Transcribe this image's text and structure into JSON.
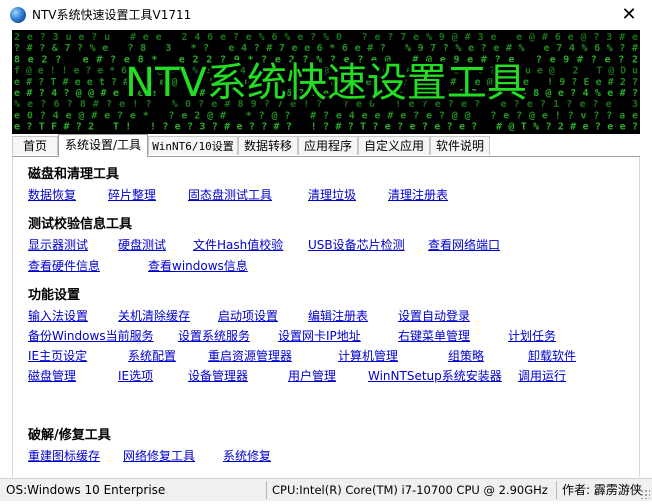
{
  "window": {
    "title": "NTV系统快速设置工具V1711",
    "close_symbol": "✕"
  },
  "banner": {
    "title": "NTV系统快速设置工具",
    "title_color": "#22dd22",
    "matrix_color": "#33cc33",
    "rows": [
      "2e?3ue?u  #ee  246e?e%6%e?%0  ?e?7e%9@#3e  e@#6e@?3#e",
      "?#?&7?%e  ?8 3  *? e4?#7ee6*6e#? %97?%e?e#%  e74%6%?#",
      "8e2?  e#?e8*  e22?9*?e2?%?e?e@  #@e9e#?e  ?e9#?e?2",
      "f@e!!e?e*6e   @8?%e? 4  ? e?#@ e?  e?e9? 2 8?29ue@ 2 T@Du",
      "e#?T#eet?#?  e@2*!#?u#?  @?e?% e?e?e?  #?e@e?e  !9?Ee#2?",
      "e#?4?@@#e?ee?  ?#T?3?  e6??e?4?e?%  uve?2e? #8@e?4%e#?",
      "%e?6?8#?e!?  %0?e#89?7e!?  ?e0 !e?e?e?  e?e?1?e?e 3",
      "e0?4e@#e?e*  ?e2@#  *?@?  #?e4ee#e?e?@@  ?e?@e!?v??ae",
      "e?TF#?2 T!  !?e?3?#e??#?  !?#?T?e?e?e?e?  #@T%?2#e?ee?"
    ]
  },
  "tabs": [
    {
      "label": "首页"
    },
    {
      "label": "系统设置/工具"
    },
    {
      "label": "WinNT6/10设置"
    },
    {
      "label": "数据转移"
    },
    {
      "label": "应用程序"
    },
    {
      "label": "自定义应用"
    },
    {
      "label": "软件说明"
    }
  ],
  "sections": {
    "disk": {
      "title": "磁盘和清理工具",
      "links": [
        "数据恢复",
        "碎片整理",
        "固态盘测试工具",
        "清理垃圾",
        "清理注册表"
      ]
    },
    "test": {
      "title": "测试校验信息工具",
      "links": [
        "显示器测试",
        "硬盘测试",
        "文件Hash值校验",
        "USB设备芯片检测",
        "查看网络端口",
        "查看硬件信息",
        "查看windows信息"
      ]
    },
    "func": {
      "title": "功能设置",
      "links": [
        "输入法设置",
        "关机清除缓存",
        "启动项设置",
        "编辑注册表",
        "设置自动登录",
        "备份Windows当前服务",
        "设置系统服务",
        "设置网卡IP地址",
        "右键菜单管理",
        "计划任务",
        "IE主页设定",
        "系统配置",
        "重启资源管理器",
        "计算机管理",
        "组策略",
        "卸载软件",
        "磁盘管理",
        "IE选项",
        "设备管理器",
        "用户管理",
        "WinNTSetup系统安装器",
        "调用运行"
      ]
    },
    "repair": {
      "title": "破解/修复工具",
      "links": [
        "重建图标缓存",
        "网络修复工具",
        "系统修复"
      ]
    }
  },
  "status": {
    "os": "OS:Windows 10 Enterprise",
    "cpu": "CPU:Intel(R) Core(TM) i7-10700 CPU @ 2.90GHz",
    "author": "作者: 霹雳游侠"
  }
}
